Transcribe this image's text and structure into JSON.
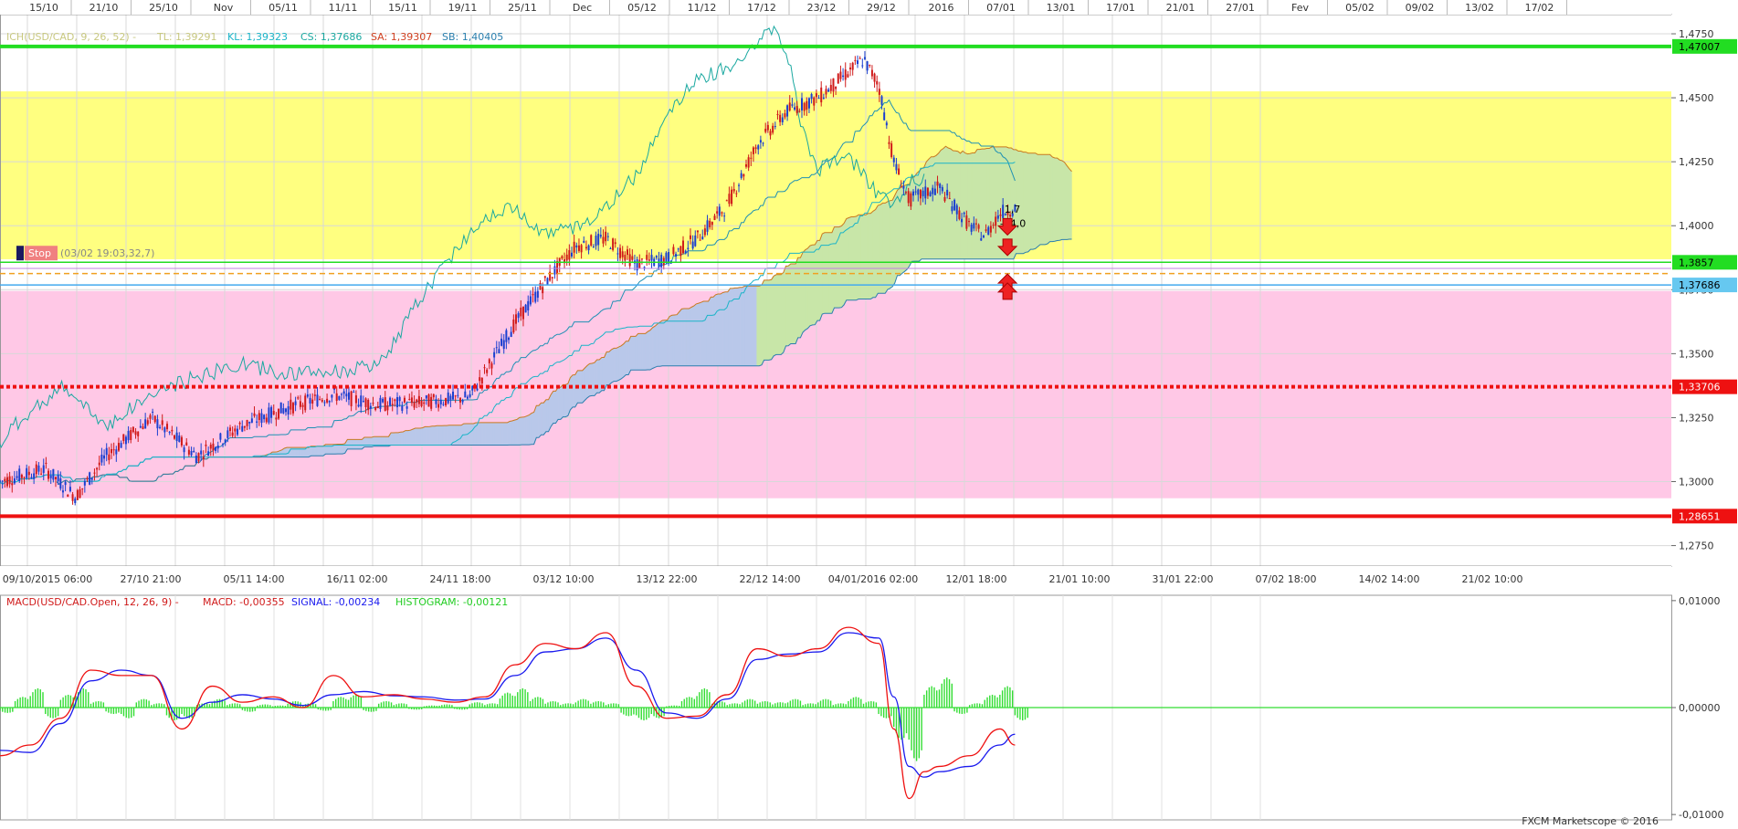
{
  "footer": "FXCM Marketscope © 2016",
  "colors": {
    "candle_up": "#1a3fd0",
    "candle_down": "#d01a1a",
    "tenkan": "#1e90b4",
    "kijun": "#1ab4c8",
    "chikou": "#1aa8a0",
    "cloud_bull": "#c8e6a8",
    "cloud_bear": "#f3c98a",
    "cloud_bull_alt": "#b9c8ea",
    "cloud_bear_alt": "#f3a8b4",
    "zone_yellow": "#ffff80",
    "zone_pink": "#ffc8e6",
    "line_green": "#22dd22",
    "line_red": "#ee1111",
    "macd": "#ee1111",
    "signal": "#1a1aee",
    "histogram": "#33dd33"
  },
  "chart_data": [
    {
      "type": "candlestick",
      "title": "",
      "top_axis_labels": [
        "15/10",
        "21/10",
        "25/10",
        "Nov",
        "05/11",
        "11/11",
        "15/11",
        "19/11",
        "25/11",
        "Dec",
        "05/12",
        "11/12",
        "17/12",
        "23/12",
        "29/12",
        "2016",
        "07/01",
        "13/01",
        "17/01",
        "21/01",
        "27/01",
        "Fev",
        "05/02",
        "09/02",
        "13/02",
        "17/02"
      ],
      "bottom_axis_labels": [
        "09/10/2015 06:00",
        "27/10 21:00",
        "05/11 14:00",
        "16/11 02:00",
        "24/11 18:00",
        "03/12 10:00",
        "13/12 22:00",
        "22/12 14:00",
        "04/01/2016 02:00",
        "12/01 18:00",
        "21/01 10:00",
        "31/01 22:00",
        "07/02 18:00",
        "14/02 14:00",
        "21/02 10:00"
      ],
      "y_ticks": [
        "1,4750",
        "1,4500",
        "1,4250",
        "1,4000",
        "1,3750",
        "1,3500",
        "1,3250",
        "1,3000",
        "1,2750"
      ],
      "ylim": [
        1.267,
        1.4825
      ],
      "indicator_legend": {
        "ich": "ICH(USD/CAD, 9, 26, 52) -",
        "tl": "TL: 1,39291",
        "kl": "KL: 1,39323",
        "cs": "CS: 1,37686",
        "sa": "SA: 1,39307",
        "sb": "SB: 1,40405"
      },
      "levels": [
        {
          "name": "resistance",
          "value": 1.47007,
          "label": "1,47007",
          "color": "#22dd22",
          "style": "solid"
        },
        {
          "name": "entry",
          "value": 1.3857,
          "label": "1,3857",
          "color": "#22dd22",
          "style": "solid"
        },
        {
          "name": "mid",
          "value": 1.37686,
          "label": "1,37686",
          "color": "#44aaee",
          "style": "solid"
        },
        {
          "name": "dotted",
          "value": 1.33706,
          "label": "1,33706",
          "color": "#ee1111",
          "style": "dotted"
        },
        {
          "name": "support",
          "value": 1.28651,
          "label": "1,28651",
          "color": "#ee1111",
          "style": "solid"
        }
      ],
      "zones": [
        {
          "name": "yellow-zone",
          "from": 1.3869,
          "to": 1.4525,
          "color": "#ffff80"
        },
        {
          "name": "pink-zone",
          "from": 1.2935,
          "to": 1.3745,
          "color": "#ffc8e6"
        }
      ],
      "stop_marker": {
        "label": "Stop",
        "detail": "(03/02 19:03,32,7)",
        "value": 1.3893
      },
      "annotations": [
        {
          "text": "1,7",
          "x": 66.3,
          "value": 1.405
        },
        {
          "text": "-44,0",
          "x": 66.0,
          "value": 1.3995
        }
      ],
      "series_points": {
        "close_keypoints_x": [
          0,
          3,
          5,
          7,
          10,
          13,
          16,
          19,
          22,
          25,
          28,
          31,
          34,
          36,
          38,
          40,
          42,
          44,
          46,
          48,
          50,
          52,
          54,
          56,
          57,
          58,
          59,
          60,
          62,
          64,
          65,
          66,
          67
        ],
        "close_keypoints_y": [
          1.3,
          1.305,
          1.294,
          1.31,
          1.325,
          1.31,
          1.322,
          1.329,
          1.334,
          1.33,
          1.331,
          1.333,
          1.362,
          1.378,
          1.392,
          1.395,
          1.385,
          1.387,
          1.395,
          1.408,
          1.432,
          1.445,
          1.45,
          1.46,
          1.465,
          1.455,
          1.425,
          1.41,
          1.415,
          1.4,
          1.396,
          1.405,
          1.407
        ]
      }
    },
    {
      "type": "line",
      "title": "",
      "legend": {
        "macd_title": "MACD(USD/CAD.Open, 12, 26, 9) -",
        "macd": "MACD: -0,00355",
        "signal": "SIGNAL: -0,00234",
        "histogram": "HISTOGRAM: -0,00121"
      },
      "y_ticks": [
        "0,01000",
        "0,00000",
        "-0,01000"
      ],
      "ylim": [
        -0.0105,
        0.0105
      ],
      "series": [
        {
          "name": "MACD",
          "x": [
            0,
            2,
            4,
            6,
            8,
            10,
            12,
            14,
            16,
            18,
            20,
            22,
            24,
            26,
            28,
            30,
            32,
            34,
            36,
            38,
            40,
            42,
            44,
            46,
            48,
            50,
            52,
            54,
            56,
            58,
            59,
            60,
            61,
            62,
            64,
            66,
            67
          ],
          "values": [
            -0.0045,
            -0.0035,
            -0.001,
            0.0035,
            0.003,
            0.003,
            -0.002,
            0.002,
            0.0005,
            0.001,
            0.0,
            0.003,
            0.001,
            0.0012,
            0.0008,
            0.0005,
            0.001,
            0.004,
            0.006,
            0.0055,
            0.007,
            0.002,
            -0.001,
            -0.0008,
            0.0012,
            0.0055,
            0.0048,
            0.0055,
            0.0075,
            0.006,
            -0.002,
            -0.0085,
            -0.006,
            -0.0055,
            -0.0045,
            -0.002,
            -0.0035
          ]
        },
        {
          "name": "SIGNAL",
          "x": [
            0,
            2,
            4,
            6,
            8,
            10,
            12,
            14,
            16,
            18,
            20,
            22,
            24,
            26,
            28,
            30,
            32,
            34,
            36,
            38,
            40,
            42,
            44,
            46,
            48,
            50,
            52,
            54,
            56,
            58,
            59,
            60,
            61,
            62,
            64,
            66,
            67
          ],
          "values": [
            -0.004,
            -0.0042,
            -0.0015,
            0.0025,
            0.0035,
            0.003,
            -0.001,
            0.0005,
            0.0012,
            0.0008,
            0.0002,
            0.0012,
            0.0015,
            0.0011,
            0.001,
            0.0007,
            0.0008,
            0.003,
            0.0052,
            0.0055,
            0.0065,
            0.0035,
            -0.0005,
            -0.001,
            0.0008,
            0.0045,
            0.005,
            0.0052,
            0.007,
            0.0065,
            0.001,
            -0.0055,
            -0.0065,
            -0.006,
            -0.0055,
            -0.0035,
            -0.0025
          ]
        },
        {
          "name": "HISTOGRAM",
          "type": "bar",
          "x": [
            0,
            1,
            2,
            3,
            4,
            5,
            6,
            7,
            8,
            9,
            10,
            11,
            12,
            13,
            14,
            15,
            16,
            17,
            18,
            19,
            20,
            21,
            22,
            23,
            24,
            25,
            26,
            27,
            28,
            29,
            30,
            31,
            32,
            33,
            34,
            35,
            36,
            37,
            38,
            39,
            40,
            41,
            42,
            43,
            44,
            45,
            46,
            47,
            48,
            49,
            50,
            51,
            52,
            53,
            54,
            55,
            56,
            57,
            58,
            59,
            60,
            61,
            62,
            63,
            64,
            65,
            66,
            67
          ],
          "values": [
            -0.0005,
            0.001,
            0.0018,
            -0.001,
            0.0012,
            0.0018,
            0.0006,
            -0.0006,
            -0.001,
            0.0008,
            0.0004,
            -0.0012,
            -0.001,
            0.0004,
            0.0008,
            0.0004,
            -0.0004,
            0.0003,
            0.0002,
            0.0006,
            0.0004,
            -0.0003,
            0.001,
            0.0012,
            -0.0004,
            0.0006,
            0.0004,
            -0.0002,
            0.0002,
            0.0003,
            -0.0002,
            0.0005,
            0.0004,
            0.0014,
            0.0018,
            0.001,
            0.0006,
            0.0004,
            0.0008,
            0.0006,
            0.0004,
            -0.0008,
            -0.0012,
            -0.001,
            0.0002,
            0.001,
            0.0018,
            0.0006,
            0.0004,
            0.0008,
            0.0006,
            0.0005,
            0.0008,
            0.0004,
            0.0008,
            0.0004,
            0.001,
            0.0006,
            -0.001,
            -0.003,
            -0.005,
            0.002,
            0.0028,
            -0.0006,
            0.0004,
            0.0012,
            0.002,
            -0.0012
          ]
        }
      ]
    }
  ]
}
